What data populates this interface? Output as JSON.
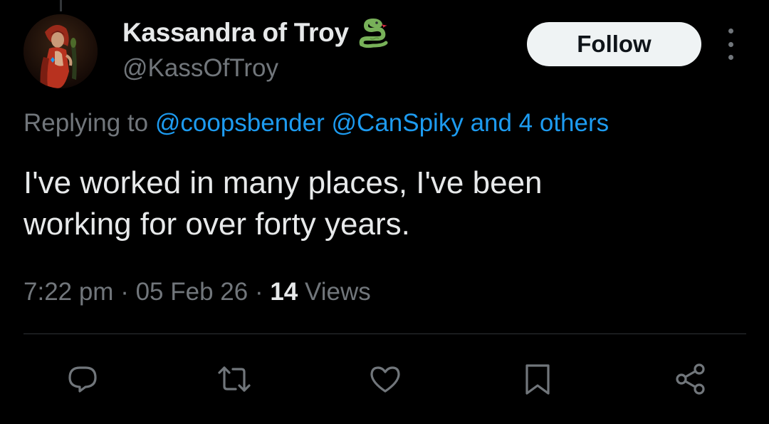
{
  "tweet": {
    "author": {
      "display_name": "Kassandra of Troy",
      "name_emoji": "snake-emoji",
      "handle": "@KassOfTroy",
      "avatar": "painted-portrait-avatar"
    },
    "follow_label": "Follow",
    "reply_context": {
      "prefix": "Replying to",
      "mention_1": "@coopsbender",
      "mention_2": "@CanSpiky",
      "others": "and 4 others"
    },
    "body_line_1": "I've worked in many places, I've been",
    "body_line_2": "working for over forty years.",
    "meta": {
      "time": "7:22 pm",
      "separator": "·",
      "date": "05 Feb 26",
      "views_count": "14",
      "views_label": "Views"
    },
    "actions": [
      "reply-icon",
      "retweet-icon",
      "like-icon",
      "bookmark-icon",
      "share-icon"
    ]
  },
  "colors": {
    "background": "#000000",
    "text_primary": "#e7e9ea",
    "text_secondary": "#71767b",
    "accent": "#1d9bf0",
    "follow_bg": "#eff3f4",
    "divider": "#2f3336"
  }
}
